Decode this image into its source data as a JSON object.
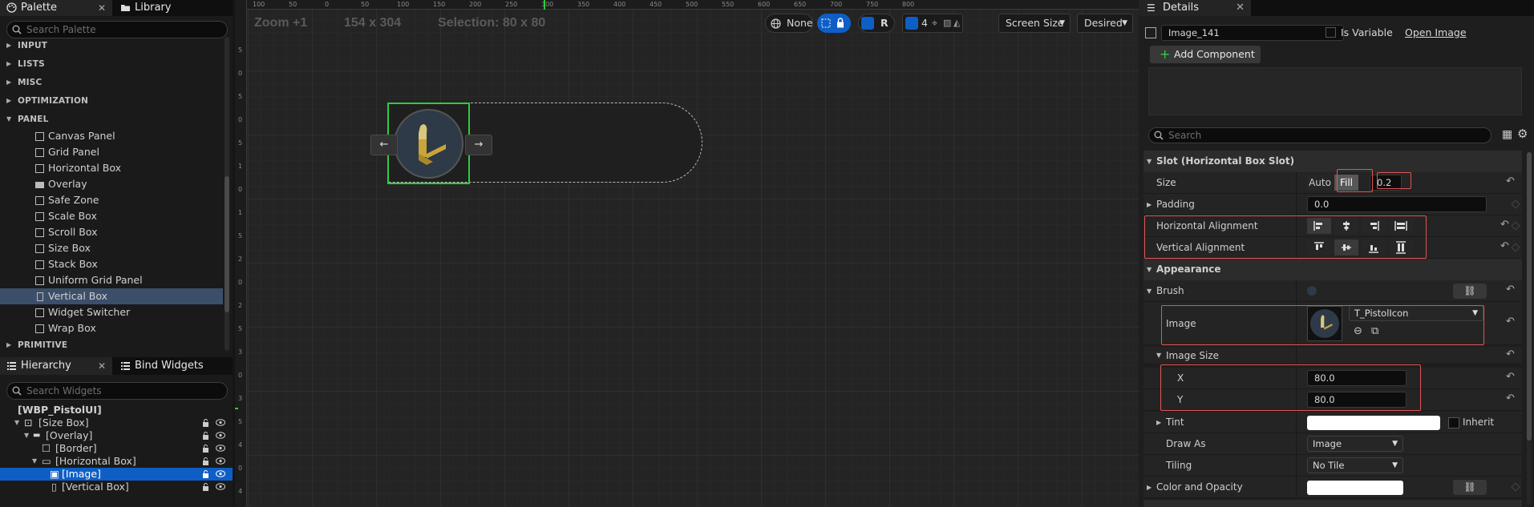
{
  "palette": {
    "tab_label": "Palette",
    "library_label": "Library",
    "search_placeholder": "Search Palette",
    "categories": [
      "INPUT",
      "LISTS",
      "MISC",
      "OPTIMIZATION",
      "PANEL"
    ],
    "panel_items": [
      "Canvas Panel",
      "Grid Panel",
      "Horizontal Box",
      "Overlay",
      "Safe Zone",
      "Scale Box",
      "Scroll Box",
      "Size Box",
      "Stack Box",
      "Uniform Grid Panel",
      "Vertical Box",
      "Widget Switcher",
      "Wrap Box"
    ],
    "selected_item": "Vertical Box",
    "next_category": "PRIMITIVE"
  },
  "hierarchy": {
    "tab_label": "Hierarchy",
    "bind_tab_label": "Bind Widgets",
    "search_placeholder": "Search Widgets",
    "rows": [
      {
        "label": "[WBP_PistolUI]"
      },
      {
        "label": "[Size Box]"
      },
      {
        "label": "[Overlay]"
      },
      {
        "label": "[Border]"
      },
      {
        "label": "[Horizontal Box]"
      },
      {
        "label": "[Image]"
      },
      {
        "label": "[Vertical Box]"
      }
    ],
    "selected": "[Image]"
  },
  "canvas": {
    "zoom": "Zoom +1",
    "size": "154 x 304",
    "selection": "Selection: 80 x 80",
    "ruler_top": [
      "100",
      "50",
      "0",
      "50",
      "100",
      "150",
      "200",
      "250",
      "300",
      "350",
      "400",
      "450",
      "500",
      "550",
      "600",
      "650",
      "700",
      "750",
      "800"
    ],
    "ruler_left": [
      "5",
      "0",
      "5",
      "0",
      "5",
      "1",
      "0",
      "1",
      "5",
      "2",
      "0",
      "2",
      "5",
      "3",
      "0",
      "3",
      "5",
      "4",
      "0",
      "4"
    ],
    "toolbar": {
      "none_label": "None",
      "r_label": "R",
      "grid_count": "4",
      "screen_size_label": "Screen Size",
      "desired_label": "Desired"
    },
    "arrow_left": "←",
    "arrow_right": "→"
  },
  "details": {
    "tab_label": "Details",
    "widget_name": "Image_141",
    "is_variable_label": "Is Variable",
    "open_image_label": "Open Image",
    "add_component_label": "Add Component",
    "search_placeholder": "Search",
    "slot_section": "Slot (Horizontal Box Slot)",
    "size_label": "Size",
    "size_auto": "Auto",
    "size_fill": "Fill",
    "size_value": "0.2",
    "padding_label": "Padding",
    "padding_value": "0.0",
    "h_align_label": "Horizontal Alignment",
    "v_align_label": "Vertical Alignment",
    "appearance_section": "Appearance",
    "brush_label": "Brush",
    "image_label": "Image",
    "image_asset": "T_PistolIcon",
    "image_size_label": "Image Size",
    "x_label": "X",
    "x_value": "80.0",
    "y_label": "Y",
    "y_value": "80.0",
    "tint_label": "Tint",
    "inherit_label": "Inherit",
    "draw_as_label": "Draw As",
    "draw_as_value": "Image",
    "tiling_label": "Tiling",
    "tiling_value": "No Tile",
    "color_opacity_label": "Color and Opacity",
    "colors": {
      "accent": "#0e5ec6",
      "highlight": "#e05555",
      "selection_green": "#2ecc40"
    }
  }
}
